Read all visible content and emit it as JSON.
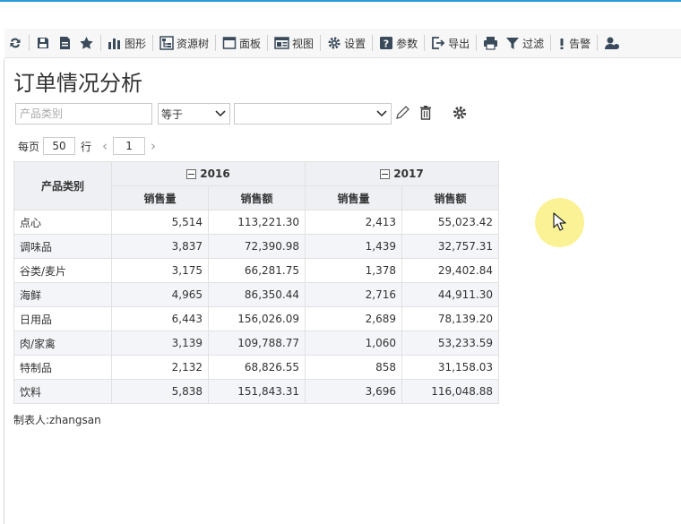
{
  "toolbar": {
    "items": [
      {
        "icon": "refresh-icon",
        "label": ""
      },
      {
        "icon": "save-icon",
        "label": ""
      },
      {
        "icon": "save-as-icon",
        "label": ""
      },
      {
        "icon": "star-icon",
        "label": ""
      },
      {
        "icon": "bar-chart-icon",
        "label": "图形"
      },
      {
        "icon": "resource-tree-icon",
        "label": "资源树"
      },
      {
        "icon": "panel-icon",
        "label": "面板"
      },
      {
        "icon": "view-icon",
        "label": "视图"
      },
      {
        "icon": "gear-icon",
        "label": "设置"
      },
      {
        "icon": "help-icon",
        "label": "参数"
      },
      {
        "icon": "export-icon",
        "label": "导出"
      },
      {
        "icon": "print-icon",
        "label": ""
      },
      {
        "icon": "filter-icon",
        "label": "过滤"
      },
      {
        "icon": "alert-icon",
        "label": "告警"
      },
      {
        "icon": "user-icon",
        "label": ""
      }
    ]
  },
  "report": {
    "title": "订单情况分析",
    "footer": "制表人:zhangsan"
  },
  "filter": {
    "field_placeholder": "产品类别",
    "operator": "等于",
    "value": ""
  },
  "pager": {
    "per_page_label": "每页",
    "per_page_value": "50",
    "rows_label": "行",
    "page": "1"
  },
  "table": {
    "row_header": "产品类别",
    "years": [
      "2016",
      "2017"
    ],
    "measures": [
      "销售量",
      "销售额"
    ],
    "rows": [
      {
        "category": "点心",
        "q2016": "5,514",
        "s2016": "113,221.30",
        "q2017": "2,413",
        "s2017": "55,023.42"
      },
      {
        "category": "调味品",
        "q2016": "3,837",
        "s2016": "72,390.98",
        "q2017": "1,439",
        "s2017": "32,757.31"
      },
      {
        "category": "谷类/麦片",
        "q2016": "3,175",
        "s2016": "66,281.75",
        "q2017": "1,378",
        "s2017": "29,402.84"
      },
      {
        "category": "海鲜",
        "q2016": "4,965",
        "s2016": "86,350.44",
        "q2017": "2,716",
        "s2017": "44,911.30"
      },
      {
        "category": "日用品",
        "q2016": "6,443",
        "s2016": "156,026.09",
        "q2017": "2,689",
        "s2017": "78,139.20"
      },
      {
        "category": "肉/家禽",
        "q2016": "3,139",
        "s2016": "109,788.77",
        "q2017": "1,060",
        "s2017": "53,233.59"
      },
      {
        "category": "特制品",
        "q2016": "2,132",
        "s2016": "68,826.55",
        "q2017": "858",
        "s2017": "31,158.03"
      },
      {
        "category": "饮料",
        "q2016": "5,838",
        "s2016": "151,843.31",
        "q2017": "3,696",
        "s2017": "116,048.88"
      }
    ]
  },
  "colors": {
    "accent": "#2a9bd6",
    "header_bg": "#eef0f3",
    "cursor_highlight": "#faf082"
  }
}
